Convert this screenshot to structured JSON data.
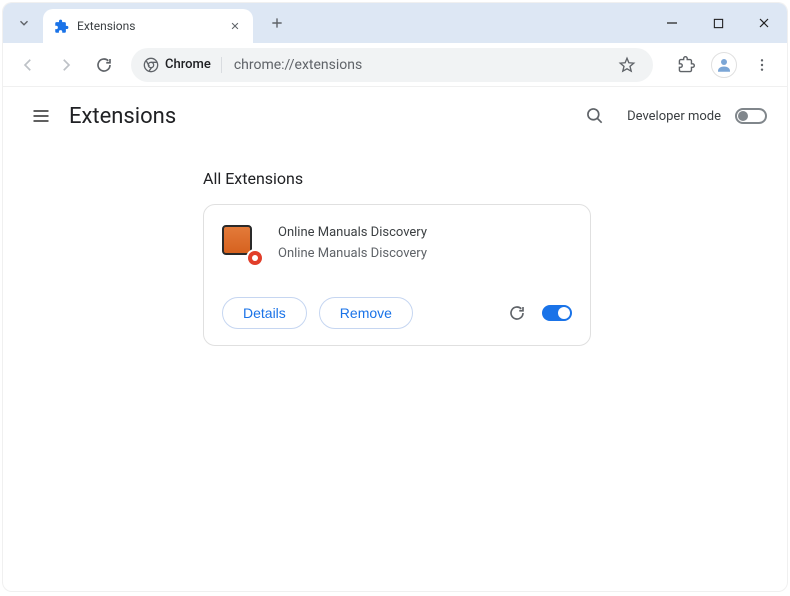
{
  "tab": {
    "title": "Extensions"
  },
  "omnibox": {
    "chip_label": "Chrome",
    "url": "chrome://extensions"
  },
  "page": {
    "title": "Extensions",
    "dev_mode_label": "Developer mode",
    "dev_mode_enabled": false
  },
  "section": {
    "title": "All Extensions"
  },
  "extension": {
    "name": "Online Manuals Discovery",
    "description": "Online Manuals Discovery",
    "enabled": true,
    "details_label": "Details",
    "remove_label": "Remove"
  }
}
